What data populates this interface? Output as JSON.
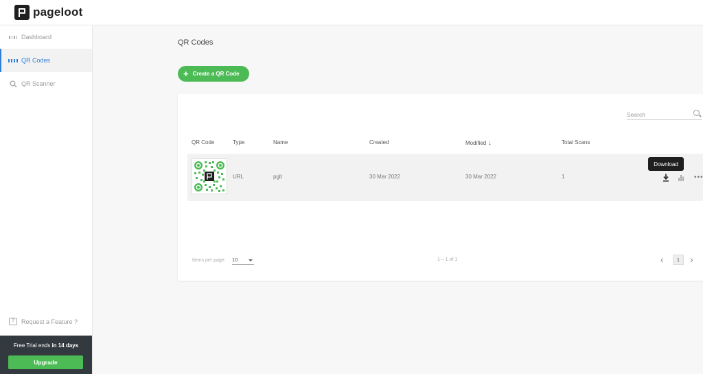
{
  "header": {
    "logo_text": "pageloot"
  },
  "sidebar": {
    "items": [
      {
        "label": "Dashboard",
        "icon": "dashboard-icon"
      },
      {
        "label": "QR Codes",
        "icon": "qr-code-icon"
      },
      {
        "label": "QR Scanner",
        "icon": "search-icon"
      }
    ],
    "request_feature": "Request a Feature ?",
    "trial_prefix": "Free Trial ends",
    "trial_bold": "in 14 days",
    "upgrade_label": "Upgrade"
  },
  "main": {
    "title": "QR Codes",
    "create_label": "Create a QR Code",
    "search_placeholder": "Search",
    "columns": [
      "QR Code",
      "Type",
      "Name",
      "Created",
      "Modified",
      "Total Scans"
    ],
    "rows": [
      {
        "type": "URL",
        "name": "pglt",
        "created": "30 Mar 2022",
        "modified": "30 Mar 2022",
        "total_scans": "1"
      }
    ],
    "tooltip": "Download",
    "items_per_page_label": "Items per page:",
    "items_per_page_value": "10",
    "range": "1 – 1 of 1",
    "page": "1"
  },
  "colors": {
    "accent": "#4cbb55",
    "active_nav": "#2f7fd8",
    "qr_green": "#4cbb55"
  }
}
